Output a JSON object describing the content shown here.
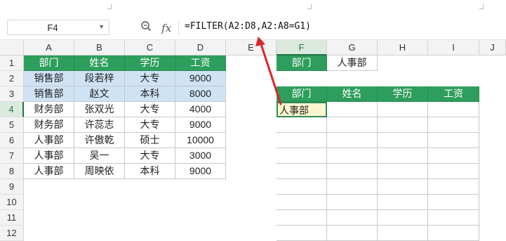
{
  "formula_bar": {
    "name_box": "F4",
    "formula": "=FILTER(A2:D8,A2:A8=G1)",
    "icons": [
      "zoom-icon",
      "fx-icon"
    ]
  },
  "sheet": {
    "columns": [
      "A",
      "B",
      "C",
      "D",
      "E",
      "F",
      "G",
      "H",
      "I",
      "J"
    ],
    "rows": [
      "1",
      "2",
      "3",
      "4",
      "5",
      "6",
      "7",
      "8",
      "9",
      "10",
      "11",
      "12"
    ],
    "source_header": [
      "部门",
      "姓名",
      "学历",
      "工资"
    ],
    "source_rows": [
      [
        "销售部",
        "段若梓",
        "大专",
        "9000"
      ],
      [
        "销售部",
        "赵文",
        "本科",
        "8000"
      ],
      [
        "财务部",
        "张双光",
        "大专",
        "4000"
      ],
      [
        "财务部",
        "许蕊志",
        "大专",
        "9000"
      ],
      [
        "人事部",
        "许傲乾",
        "硕士",
        "10000"
      ],
      [
        "人事部",
        "吴一",
        "大专",
        "3000"
      ],
      [
        "人事部",
        "周映依",
        "本科",
        "9000"
      ]
    ],
    "criteria_label": "部门",
    "criteria_value": "人事部",
    "result_header": [
      "部门",
      "姓名",
      "学历",
      "工资"
    ],
    "result_first": "人事部"
  },
  "colors": {
    "header_green": "#2e9e5c",
    "highlight_blue": "#cfe3f5",
    "arrow_red": "#d9262b",
    "active_cell": "#fbf5d0"
  }
}
